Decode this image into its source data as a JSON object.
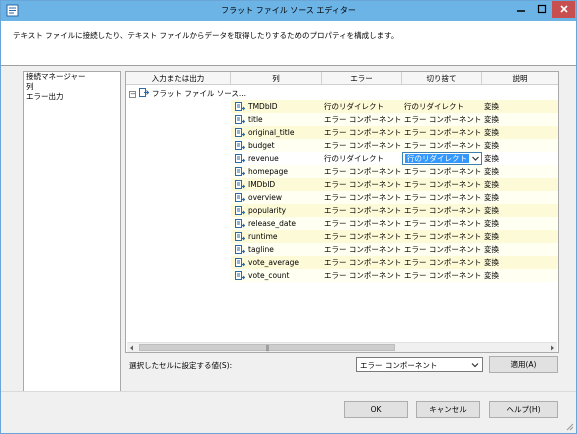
{
  "window": {
    "title": "フラット ファイル ソース エディター",
    "description": "テキスト ファイルに接続したり、テキスト ファイルからデータを取得したりするためのプロパティを構成します。"
  },
  "nav": {
    "items": [
      {
        "label": "接続マネージャー"
      },
      {
        "label": "列"
      },
      {
        "label": "エラー出力"
      }
    ]
  },
  "grid": {
    "headers": {
      "io": "入力または出力",
      "column": "列",
      "error": "エラー",
      "truncation": "切り捨て",
      "description": "説明"
    },
    "root_label": "フラット ファイル ソース...",
    "rows": [
      {
        "name": "TMDbID",
        "error": "行のリダイレクト",
        "truncation": "行のリダイレクト",
        "description": "変換"
      },
      {
        "name": "title",
        "error": "エラー コンポーネント",
        "truncation": "エラー コンポーネント",
        "description": "変換"
      },
      {
        "name": "original_title",
        "error": "エラー コンポーネント",
        "truncation": "エラー コンポーネント",
        "description": "変換"
      },
      {
        "name": "budget",
        "error": "エラー コンポーネント",
        "truncation": "エラー コンポーネント",
        "description": "変換"
      },
      {
        "name": "revenue",
        "error": "行のリダイレクト",
        "truncation": "行のリダイレクト",
        "description": "変換"
      },
      {
        "name": "homepage",
        "error": "エラー コンポーネント",
        "truncation": "エラー コンポーネント",
        "description": "変換"
      },
      {
        "name": "IMDbID",
        "error": "エラー コンポーネント",
        "truncation": "エラー コンポーネント",
        "description": "変換"
      },
      {
        "name": "overview",
        "error": "エラー コンポーネント",
        "truncation": "エラー コンポーネント",
        "description": "変換"
      },
      {
        "name": "popularity",
        "error": "エラー コンポーネント",
        "truncation": "エラー コンポーネント",
        "description": "変換"
      },
      {
        "name": "release_date",
        "error": "エラー コンポーネント",
        "truncation": "エラー コンポーネント",
        "description": "変換"
      },
      {
        "name": "runtime",
        "error": "エラー コンポーネント",
        "truncation": "エラー コンポーネント",
        "description": "変換"
      },
      {
        "name": "tagline",
        "error": "エラー コンポーネント",
        "truncation": "エラー コンポーネント",
        "description": "変換"
      },
      {
        "name": "vote_average",
        "error": "エラー コンポーネント",
        "truncation": "エラー コンポーネント",
        "description": "変換"
      },
      {
        "name": "vote_count",
        "error": "エラー コンポーネント",
        "truncation": "エラー コンポーネント",
        "description": "変換"
      }
    ],
    "active_dropdown_value": "行のリダイレクト"
  },
  "set_value": {
    "label": "選択したセルに設定する値(S):",
    "selected": "エラー コンポーネント",
    "apply_label": "適用(A)"
  },
  "buttons": {
    "ok": "OK",
    "cancel": "キャンセル",
    "help": "ヘルプ(H)"
  },
  "icons": {
    "app": "flat-file-source-icon",
    "column": "column-icon",
    "root": "output-icon"
  },
  "colors": {
    "titlebar": "#6cb3e6",
    "close_button": "#c74f50",
    "row_highlight": "#fdfad8",
    "selection": "#3399ff"
  }
}
